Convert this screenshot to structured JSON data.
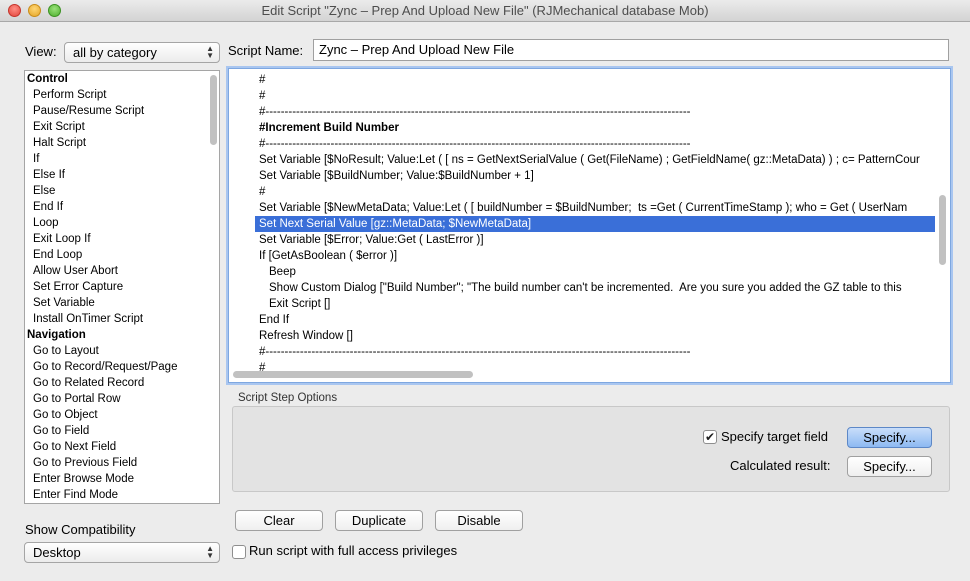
{
  "window": {
    "title": "Edit Script \"Zync – Prep And Upload New File\" (RJMechanical database Mob)"
  },
  "left": {
    "view_label": "View:",
    "view_value": "all by category",
    "steps": [
      {
        "label": "Control",
        "category": true
      },
      {
        "label": "Perform Script"
      },
      {
        "label": "Pause/Resume Script"
      },
      {
        "label": "Exit Script"
      },
      {
        "label": "Halt Script"
      },
      {
        "label": "If"
      },
      {
        "label": "Else If"
      },
      {
        "label": "Else"
      },
      {
        "label": "End If"
      },
      {
        "label": "Loop"
      },
      {
        "label": "Exit Loop If"
      },
      {
        "label": "End Loop"
      },
      {
        "label": "Allow User Abort"
      },
      {
        "label": "Set Error Capture"
      },
      {
        "label": "Set Variable"
      },
      {
        "label": "Install OnTimer Script"
      },
      {
        "label": "Navigation",
        "category": true
      },
      {
        "label": "Go to Layout"
      },
      {
        "label": "Go to Record/Request/Page"
      },
      {
        "label": "Go to Related Record"
      },
      {
        "label": "Go to Portal Row"
      },
      {
        "label": "Go to Object"
      },
      {
        "label": "Go to Field"
      },
      {
        "label": "Go to Next Field"
      },
      {
        "label": "Go to Previous Field"
      },
      {
        "label": "Enter Browse Mode"
      },
      {
        "label": "Enter Find Mode"
      }
    ],
    "compat_label": "Show Compatibility",
    "compat_value": "Desktop"
  },
  "script": {
    "name_label": "Script Name:",
    "name_value": "Zync – Prep And Upload New File",
    "lines": [
      {
        "text": "#"
      },
      {
        "text": "#"
      },
      {
        "text": "#---------------------------------------------------------------------------------------------------------------"
      },
      {
        "text": "#Increment Build Number",
        "bold": true
      },
      {
        "text": "#---------------------------------------------------------------------------------------------------------------"
      },
      {
        "text": "Set Variable [$NoResult; Value:Let ( [ ns = GetNextSerialValue ( Get(FileName) ; GetFieldName( gz::MetaData) ) ; c= PatternCour"
      },
      {
        "text": "Set Variable [$BuildNumber; Value:$BuildNumber + 1]"
      },
      {
        "text": "#"
      },
      {
        "text": "Set Variable [$NewMetaData; Value:Let ( [ buildNumber = $BuildNumber;  ts =Get ( CurrentTimeStamp ); who = Get ( UserNam"
      },
      {
        "text": "Set Next Serial Value [gz::MetaData; $NewMetaData]",
        "selected": true
      },
      {
        "text": "Set Variable [$Error; Value:Get ( LastError )]"
      },
      {
        "text": "If [GetAsBoolean ( $error )]"
      },
      {
        "text": "Beep",
        "indent": true
      },
      {
        "text": "Show Custom Dialog [\"Build Number\"; \"The build number can't be incremented.  Are you sure you added the GZ table to this",
        "indent": true
      },
      {
        "text": "Exit Script []",
        "indent": true
      },
      {
        "text": "End If"
      },
      {
        "text": "Refresh Window []"
      },
      {
        "text": "#---------------------------------------------------------------------------------------------------------------"
      },
      {
        "text": "#"
      }
    ]
  },
  "options": {
    "group_label": "Script Step Options",
    "specify_target_label": "Specify target field",
    "specify_target_checked": true,
    "specify_button": "Specify...",
    "calc_label": "Calculated result:",
    "calc_button": "Specify..."
  },
  "buttons": {
    "clear": "Clear",
    "duplicate": "Duplicate",
    "disable": "Disable"
  },
  "full_access": {
    "label": "Run script with full access privileges",
    "checked": false
  }
}
